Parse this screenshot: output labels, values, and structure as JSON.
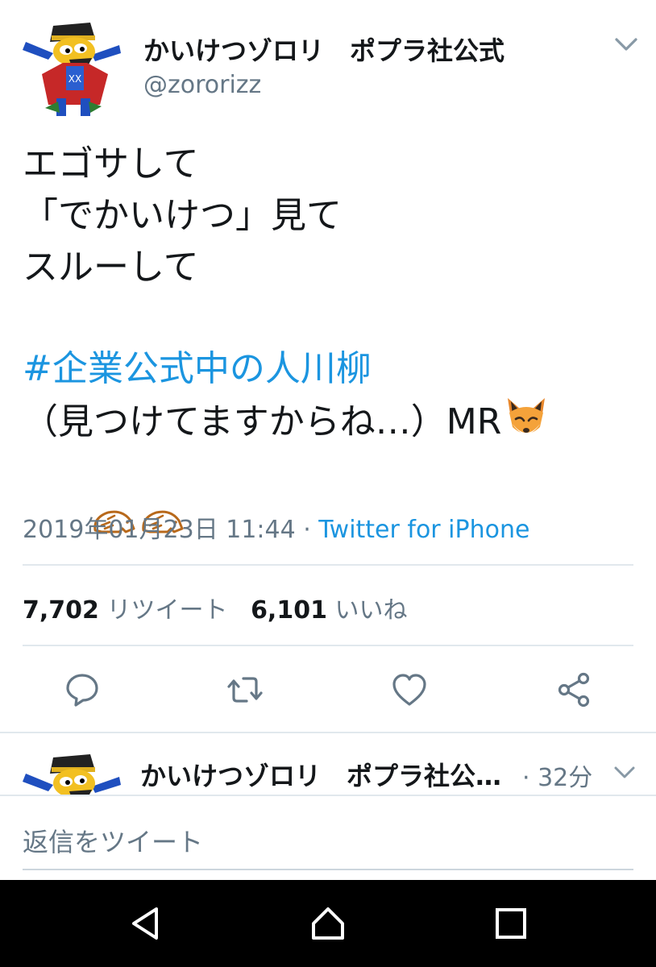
{
  "tweet": {
    "display_name": "かいけつゾロリ　ポプラ社公式",
    "handle": "@zororizz",
    "body_lines": [
      "エゴサして",
      "「でかいけつ」見て",
      "スルーして"
    ],
    "hashtag": "#企業公式中の人川柳",
    "signature_line": "（見つけてますからね…）MR",
    "emoji": [
      "fox-face-emoji",
      "hedgehog-emoji",
      "hedgehog-emoji"
    ],
    "timestamp": "2019年01月23日 11:44",
    "separator": " · ",
    "source": "Twitter for iPhone"
  },
  "stats": {
    "retweets_count": "7,702",
    "retweets_label": "リツイート",
    "likes_count": "6,101",
    "likes_label": "いいね"
  },
  "actions": [
    "reply-icon",
    "retweet-icon",
    "like-icon",
    "share-icon"
  ],
  "reply_preview": {
    "display_name": "かいけつゾロリ　ポプラ社公…",
    "time": "· 32分"
  },
  "compose": {
    "placeholder": "返信をツイート"
  },
  "navbar": [
    "back-icon",
    "home-icon",
    "recents-icon"
  ],
  "colors": {
    "accent": "#1b95e0",
    "text": "#14171a",
    "secondary": "#657786",
    "divider": "#e1e8ed",
    "fox_orange": "#f4a23a",
    "hedgehog_brown": "#b8691b"
  }
}
